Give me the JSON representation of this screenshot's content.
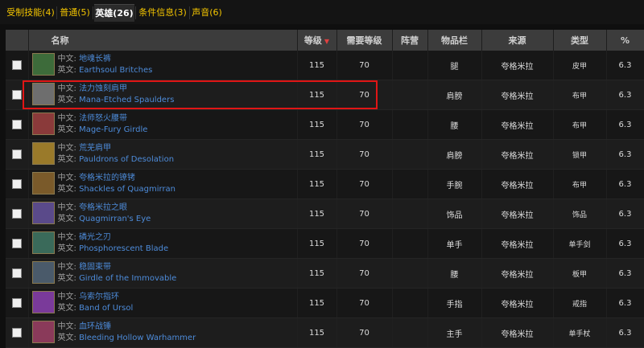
{
  "tabs": [
    {
      "label": "受制技能(4)",
      "active": false
    },
    {
      "label": "普通(5)",
      "active": false
    },
    {
      "label": "英雄(26)",
      "active": true
    },
    {
      "label": "条件信息(3)",
      "active": false
    },
    {
      "label": "声音(6)",
      "active": false
    }
  ],
  "columns": {
    "name": "名称",
    "level": "等级",
    "req_level": "需要等级",
    "faction": "阵营",
    "slot": "物品栏",
    "source": "来源",
    "type": "类型",
    "pct": "%"
  },
  "cn_prefix": "中文:",
  "en_prefix": "英文:",
  "sort_arrow": "▼",
  "rows": [
    {
      "cn": "地魂长裤",
      "en": "Earthsoul Britches",
      "level": "115",
      "req": "70",
      "faction": "",
      "slot": "腿",
      "source": "夸格米拉",
      "type": "皮甲",
      "pct": "6.3"
    },
    {
      "cn": "法力蚀刻肩甲",
      "en": "Mana-Etched Spaulders",
      "level": "115",
      "req": "70",
      "faction": "",
      "slot": "肩膀",
      "source": "夸格米拉",
      "type": "布甲",
      "pct": "6.3"
    },
    {
      "cn": "法师怒火腰带",
      "en": "Mage-Fury Girdle",
      "level": "115",
      "req": "70",
      "faction": "",
      "slot": "腰",
      "source": "夸格米拉",
      "type": "布甲",
      "pct": "6.3"
    },
    {
      "cn": "荒芜肩甲",
      "en": "Pauldrons of Desolation",
      "level": "115",
      "req": "70",
      "faction": "",
      "slot": "肩膀",
      "source": "夸格米拉",
      "type": "锁甲",
      "pct": "6.3"
    },
    {
      "cn": "夸格米拉的镣铐",
      "en": "Shackles of Quagmirran",
      "level": "115",
      "req": "70",
      "faction": "",
      "slot": "手腕",
      "source": "夸格米拉",
      "type": "布甲",
      "pct": "6.3"
    },
    {
      "cn": "夸格米拉之眼",
      "en": "Quagmirran's Eye",
      "level": "115",
      "req": "70",
      "faction": "",
      "slot": "饰品",
      "source": "夸格米拉",
      "type": "饰品",
      "pct": "6.3"
    },
    {
      "cn": "磷光之刃",
      "en": "Phosphorescent Blade",
      "level": "115",
      "req": "70",
      "faction": "",
      "slot": "单手",
      "source": "夸格米拉",
      "type": "单手剑",
      "pct": "6.3"
    },
    {
      "cn": "稳固束带",
      "en": "Girdle of the Immovable",
      "level": "115",
      "req": "70",
      "faction": "",
      "slot": "腰",
      "source": "夸格米拉",
      "type": "板甲",
      "pct": "6.3"
    },
    {
      "cn": "乌索尔指环",
      "en": "Band of Ursol",
      "level": "115",
      "req": "70",
      "faction": "",
      "slot": "手指",
      "source": "夸格米拉",
      "type": "戒指",
      "pct": "6.3"
    },
    {
      "cn": "血环战锤",
      "en": "Bleeding Hollow Warhammer",
      "level": "115",
      "req": "70",
      "faction": "",
      "slot": "主手",
      "source": "夸格米拉",
      "type": "单手杖",
      "pct": "6.3"
    }
  ],
  "icon_colors": [
    "#3d6b3a",
    "#6e6e6e",
    "#8a3a3a",
    "#9a7a2a",
    "#7a5a2a",
    "#5a4a8a",
    "#3a6a5a",
    "#4a5a6a",
    "#7a3a9a",
    "#8a3a5a"
  ]
}
